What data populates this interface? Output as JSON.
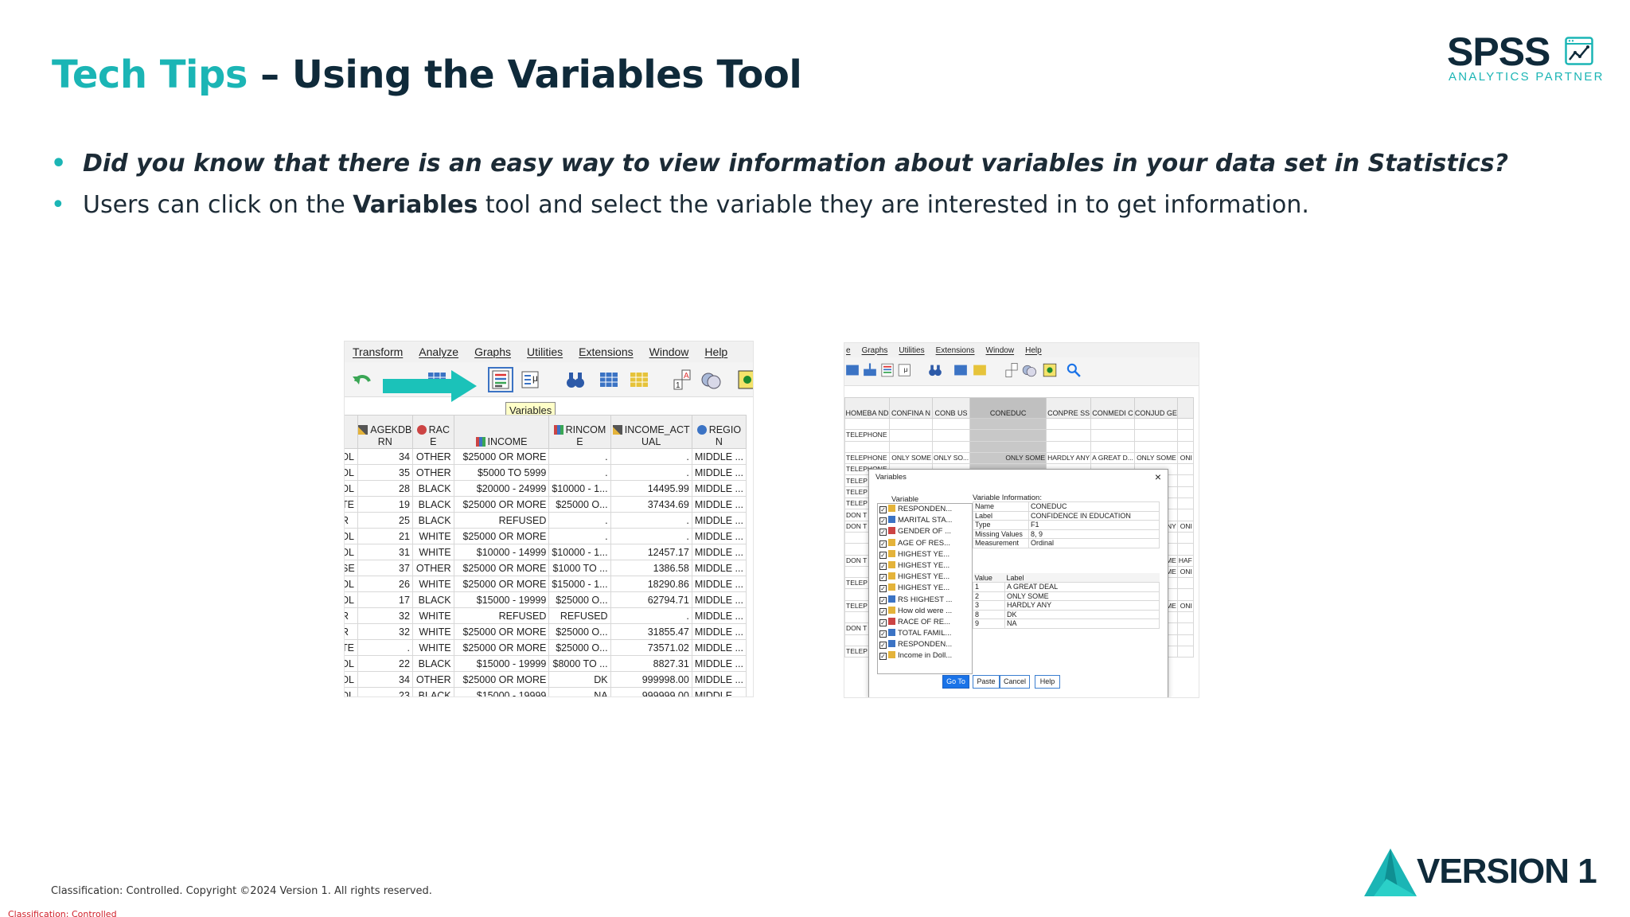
{
  "title": {
    "accent": "Tech Tips",
    "rest": " – Using the Variables Tool"
  },
  "logo": {
    "word": "SPSS",
    "tagline": "ANALYTICS PARTNER"
  },
  "bullets": {
    "b1": "Did you know that there is an easy way to view information about variables in your data set in Statistics?",
    "b2_pre": "Users can click on the ",
    "b2_bold": "Variables",
    "b2_post": " tool and select the variable they are interested in to get information."
  },
  "shot1": {
    "menu": [
      "Transform",
      "Analyze",
      "Graphs",
      "Utilities",
      "Extensions",
      "Window",
      "Help"
    ],
    "tooltip": "Variables",
    "headers": [
      "",
      "AGEKDB RN",
      "RAC E",
      "INCOME",
      "RINCOM E",
      "INCOME_ACT UAL",
      "REGIO N"
    ],
    "rows": [
      [
        "DL",
        "34",
        "OTHER",
        "$25000 OR MORE",
        ".",
        ".",
        "MIDDLE ..."
      ],
      [
        "DL",
        "35",
        "OTHER",
        "$5000 TO 5999",
        ".",
        ".",
        "MIDDLE ..."
      ],
      [
        "DL",
        "28",
        "BLACK",
        "$20000 - 24999",
        "$10000 - 1...",
        "14495.99",
        "MIDDLE ..."
      ],
      [
        "TE",
        "19",
        "BLACK",
        "$25000 OR MORE",
        "$25000 O...",
        "37434.69",
        "MIDDLE ..."
      ],
      [
        "R",
        "25",
        "BLACK",
        "REFUSED",
        ".",
        ".",
        "MIDDLE ..."
      ],
      [
        "DL",
        "21",
        "WHITE",
        "$25000 OR MORE",
        ".",
        ".",
        "MIDDLE ..."
      ],
      [
        "DL",
        "31",
        "WHITE",
        "$10000 - 14999",
        "$10000 - 1...",
        "12457.17",
        "MIDDLE ..."
      ],
      [
        "SE",
        "37",
        "OTHER",
        "$25000 OR MORE",
        "$1000 TO ...",
        "1386.58",
        "MIDDLE ..."
      ],
      [
        "DL",
        "26",
        "WHITE",
        "$25000 OR MORE",
        "$15000 - 1...",
        "18290.86",
        "MIDDLE ..."
      ],
      [
        "DL",
        "17",
        "BLACK",
        "$15000 - 19999",
        "$25000 O...",
        "62794.71",
        "MIDDLE ..."
      ],
      [
        "R",
        "32",
        "WHITE",
        "REFUSED",
        "REFUSED",
        ".",
        "MIDDLE ..."
      ],
      [
        "R",
        "32",
        "WHITE",
        "$25000 OR MORE",
        "$25000 O...",
        "31855.47",
        "MIDDLE ..."
      ],
      [
        "TE",
        ".",
        "WHITE",
        "$25000 OR MORE",
        "$25000 O...",
        "73571.02",
        "MIDDLE ..."
      ],
      [
        "DL",
        "22",
        "BLACK",
        "$15000 - 19999",
        "$8000 TO ...",
        "8827.31",
        "MIDDLE ..."
      ],
      [
        "DL",
        "34",
        "OTHER",
        "$25000 OR MORE",
        "DK",
        "999998.00",
        "MIDDLE ..."
      ],
      [
        "DL",
        "23",
        "BLACK",
        "$15000 - 19999",
        "NA",
        "999999.00",
        "MIDDLE ..."
      ]
    ]
  },
  "shot2": {
    "menu": [
      "e",
      "Graphs",
      "Utilities",
      "Extensions",
      "Window",
      "Help"
    ],
    "headers": [
      "HOMEBA ND",
      "CONFINA N",
      "CONB US",
      "CONEDUC",
      "CONPRE SS",
      "CONMEDI C",
      "CONJUD GE",
      ""
    ],
    "rows": [
      [
        "",
        "",
        "",
        "",
        "",
        "",
        "",
        ""
      ],
      [
        "TELEPHONE",
        "",
        "",
        "",
        "",
        "",
        "",
        ""
      ],
      [
        "",
        "",
        "",
        "",
        "",
        "",
        "",
        ""
      ],
      [
        "TELEPHONE",
        "ONLY SOME",
        "ONLY SO...",
        "ONLY SOME",
        "HARDLY ANY",
        "A GREAT D...",
        "ONLY SOME",
        "ONI"
      ],
      [
        "TELEPHONE",
        "",
        "",
        "",
        "",
        "",
        "",
        ""
      ],
      [
        "TELEP",
        "",
        "",
        "",
        "",
        "",
        "",
        ""
      ],
      [
        "TELEP",
        "",
        "",
        "",
        "",
        "",
        "",
        ""
      ],
      [
        "TELEP",
        "",
        "",
        "",
        "",
        "",
        "",
        ""
      ],
      [
        "DON T",
        "",
        "",
        "",
        "",
        "",
        "",
        ""
      ],
      [
        "DON T",
        "",
        "",
        "",
        "",
        "",
        "Y ANY",
        "ONI"
      ],
      [
        "",
        "",
        "",
        "",
        "",
        "",
        "",
        ""
      ],
      [
        "",
        "",
        "",
        "",
        "",
        "",
        "",
        ""
      ],
      [
        "DON T",
        "",
        "",
        "",
        "",
        "",
        "SOME",
        "HAF"
      ],
      [
        "",
        "",
        "",
        "",
        "",
        "",
        "SOME",
        "ONI"
      ],
      [
        "TELEP",
        "",
        "",
        "",
        "",
        "",
        "",
        ""
      ],
      [
        "",
        "",
        "",
        "",
        "",
        "",
        "",
        ""
      ],
      [
        "TELEP",
        "",
        "",
        "",
        "",
        "",
        "SOME",
        "ONI"
      ],
      [
        "",
        "",
        "",
        "",
        "",
        "",
        "",
        ""
      ],
      [
        "DON T",
        "",
        "",
        "",
        "",
        "",
        "",
        ""
      ],
      [
        "",
        "",
        "",
        "",
        "",
        "",
        "",
        ""
      ],
      [
        "TELEP",
        "",
        "",
        "",
        "",
        "",
        "",
        ""
      ]
    ],
    "dialog": {
      "title": "Variables",
      "list_label": "Variable",
      "info_label": "Variable Information:",
      "variables": [
        "RESPONDEN...",
        "MARITAL STA...",
        "GENDER OF ...",
        "AGE OF RES...",
        "HIGHEST YE...",
        "HIGHEST YE...",
        "HIGHEST YE...",
        "HIGHEST YE...",
        "RS HIGHEST ...",
        "How old were ...",
        "RACE OF RE...",
        "TOTAL FAMIL...",
        "RESPONDEN...",
        "Income in Doll..."
      ],
      "info": [
        [
          "Name",
          "CONEDUC"
        ],
        [
          "Label",
          "CONFIDENCE IN EDUCATION"
        ],
        [
          "Type",
          "F1"
        ],
        [
          "Missing Values",
          "8, 9"
        ],
        [
          "Measurement",
          "Ordinal"
        ]
      ],
      "value_header": [
        "Value",
        "Label"
      ],
      "values": [
        [
          "1",
          "A GREAT DEAL"
        ],
        [
          "2",
          "ONLY SOME"
        ],
        [
          "3",
          "HARDLY ANY"
        ],
        [
          "8",
          "DK"
        ],
        [
          "9",
          "NA"
        ]
      ],
      "buttons": {
        "goto": "Go To",
        "paste": "Paste",
        "cancel": "Cancel",
        "help": "Help"
      }
    }
  },
  "footer": {
    "copyright": "Classification: Controlled. Copyright ©2024 Version 1. All rights reserved.",
    "classification": "Classification: Controlled",
    "brand": "VERSION 1"
  },
  "colors": {
    "teal": "#1bb5b5",
    "navy": "#0f2a3a",
    "red": "#d0202a"
  }
}
